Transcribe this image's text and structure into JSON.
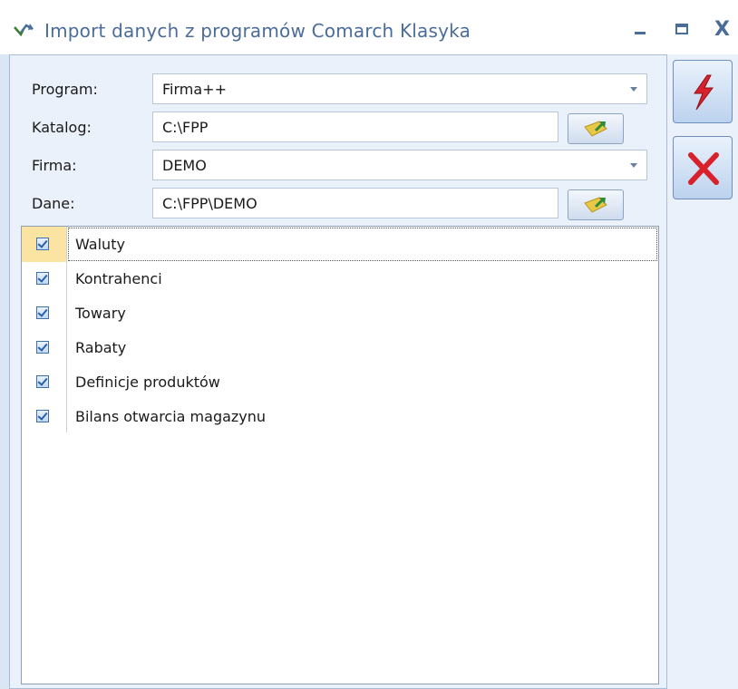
{
  "window": {
    "title": "Import danych z programów Comarch Klasyka",
    "icon": "import-arrows-icon",
    "minimize_icon": "minimize-icon",
    "maximize_icon": "maximize-icon",
    "close_symbol": "X"
  },
  "form": {
    "program": {
      "label": "Program:",
      "value": "Firma++"
    },
    "katalog": {
      "label": "Katalog:",
      "value": "C:\\FPP"
    },
    "firma": {
      "label": "Firma:",
      "value": "DEMO"
    },
    "dane": {
      "label": "Dane:",
      "value": "C:\\FPP\\DEMO"
    }
  },
  "items": [
    {
      "label": "Waluty",
      "checked": true
    },
    {
      "label": "Kontrahenci",
      "checked": true
    },
    {
      "label": "Towary",
      "checked": true
    },
    {
      "label": "Rabaty",
      "checked": true
    },
    {
      "label": "Definicje produktów",
      "checked": true
    },
    {
      "label": "Bilans otwarcia magazynu",
      "checked": true
    }
  ],
  "toolbar": {
    "run_icon": "lightning-icon",
    "cancel_icon": "red-x-icon"
  },
  "colors": {
    "accent": "#4a6c98",
    "selection": "#fbe3a2",
    "run": "#d8212b",
    "cancel": "#d8212b"
  }
}
